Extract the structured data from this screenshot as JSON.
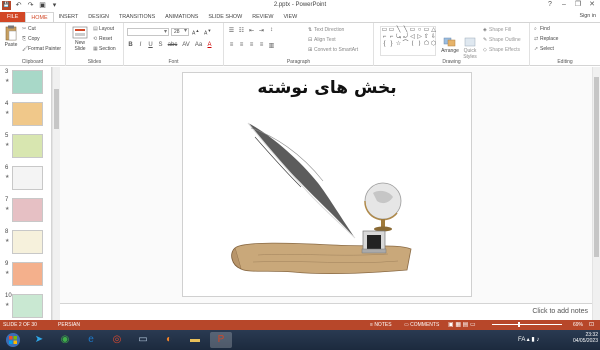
{
  "window": {
    "title": "2.pptx - PowerPoint",
    "minimize": "–",
    "restore": "❐",
    "close": "✕",
    "help": "?"
  },
  "qat": {
    "save": "💾",
    "undo": "↶",
    "redo": "↷",
    "present": "▣",
    "more": "▾"
  },
  "tabs": [
    "FILE",
    "HOME",
    "INSERT",
    "DESIGN",
    "TRANSITIONS",
    "ANIMATIONS",
    "SLIDE SHOW",
    "REVIEW",
    "VIEW"
  ],
  "active_tab": "HOME",
  "signin": "Sign in",
  "ribbon": {
    "clipboard": {
      "label": "Clipboard",
      "paste": "Paste",
      "cut": "Cut",
      "copy": "Copy",
      "format_painter": "Format Painter"
    },
    "slides": {
      "label": "Slides",
      "new_slide": "New Slide",
      "layout": "Layout",
      "reset": "Reset",
      "section": "Section"
    },
    "font": {
      "label": "Font",
      "size": "28",
      "bold": "B",
      "italic": "I",
      "underline": "U",
      "shadow": "S",
      "strike": "abc",
      "spacing": "AV",
      "case": "Aa",
      "color": "A"
    },
    "paragraph": {
      "label": "Paragraph",
      "text_direction": "Text Direction",
      "align_text": "Align Text",
      "convert_smartart": "Convert to SmartArt"
    },
    "drawing": {
      "label": "Drawing",
      "arrange": "Arrange",
      "quick_styles": "Quick Styles",
      "shape_fill": "Shape Fill",
      "shape_outline": "Shape Outline",
      "shape_effects": "Shape Effects",
      "shapes": [
        "▭",
        "▭",
        "╲",
        "╲",
        "▭",
        "○",
        "▭",
        "△",
        "⌐",
        "⌐",
        "⤿",
        "⤾",
        "◁",
        "▷",
        "⇧",
        "⇩",
        "{",
        "}",
        "☆",
        "⌒",
        "⟨",
        "⟩",
        "⬠",
        "⬡"
      ]
    },
    "editing": {
      "label": "Editing",
      "find": "Find",
      "replace": "Replace",
      "select": "Select"
    }
  },
  "thumbnails": [
    {
      "num": "3",
      "star": "★",
      "color": "#a8d8c8"
    },
    {
      "num": "4",
      "star": "★",
      "color": "#f0c88a"
    },
    {
      "num": "5",
      "star": "★",
      "color": "#d8e6b0"
    },
    {
      "num": "6",
      "star": "★",
      "color": "#f4f4f4"
    },
    {
      "num": "7",
      "star": "★",
      "color": "#e6c0c4"
    },
    {
      "num": "8",
      "star": "★",
      "color": "#f6f1dc"
    },
    {
      "num": "9",
      "star": "★",
      "color": "#f4b08c"
    },
    {
      "num": "10",
      "star": "★",
      "color": "#c9e8d2"
    }
  ],
  "slide": {
    "title": "بخش های نوشته"
  },
  "notes_placeholder": "Click to add notes",
  "status": {
    "slide_of": "SLIDE 2 OF 30",
    "language": "PERSIAN",
    "notes": "NOTES",
    "comments": "COMMENTS",
    "zoom": "69%"
  },
  "taskbar": {
    "time": "23:32",
    "date": "04/05/2023",
    "lang": "FA"
  }
}
